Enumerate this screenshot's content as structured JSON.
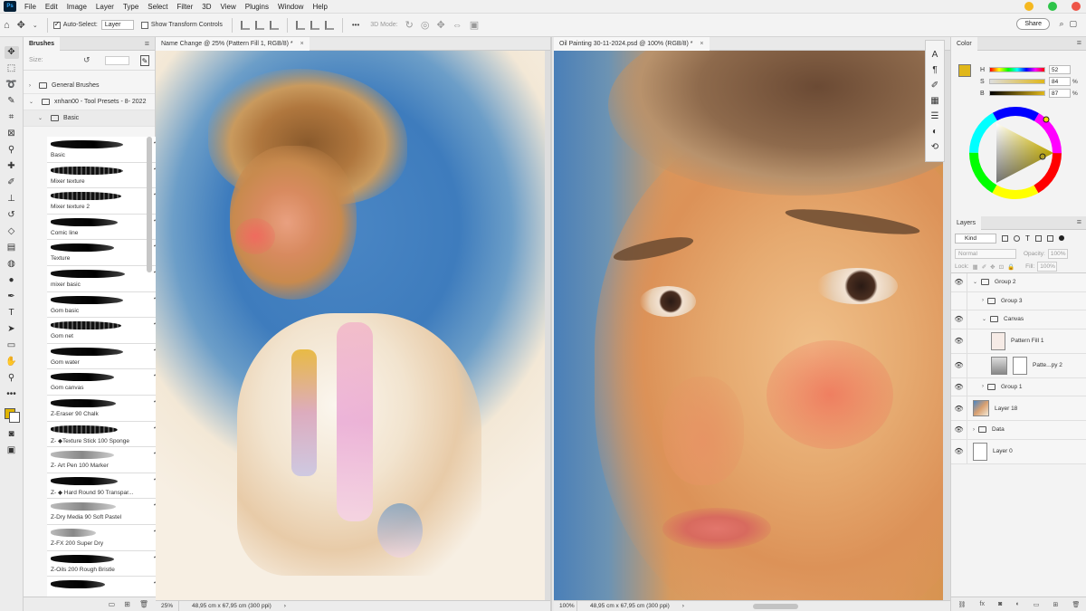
{
  "app": {
    "logo": "Ps",
    "menu": [
      "File",
      "Edit",
      "Image",
      "Layer",
      "Type",
      "Select",
      "Filter",
      "3D",
      "View",
      "Plugins",
      "Window",
      "Help"
    ],
    "window_controls": {
      "minimize_color": "#f5b820",
      "maximize_color": "#2ec449",
      "close_color": "#ee5548"
    }
  },
  "options_bar": {
    "auto_select_label": "Auto-Select:",
    "auto_select_checked": true,
    "auto_select_value": "Layer",
    "transform_label": "Show Transform Controls",
    "mode_3d_label": "3D Mode:",
    "more_label": "•••",
    "share_label": "Share"
  },
  "brushes": {
    "tab_label": "Brushes",
    "size_label": "Size:",
    "groups": [
      {
        "label": "General Brushes"
      },
      {
        "label": "xnhan00 - Tool Presets - 8- 2022"
      },
      {
        "label": "Basic"
      }
    ],
    "items": [
      {
        "name": "Basic"
      },
      {
        "name": "Mixer texture"
      },
      {
        "name": "Mixer texture 2"
      },
      {
        "name": "Comic line"
      },
      {
        "name": "Texture"
      },
      {
        "name": "mixer basic"
      },
      {
        "name": "Gom basic"
      },
      {
        "name": "Gom net"
      },
      {
        "name": "Gom water"
      },
      {
        "name": "Gom canvas"
      },
      {
        "name": "Z-Eraser 90 Chalk"
      },
      {
        "name": "Z- ◆Texture Stick 100 Sponge"
      },
      {
        "name": "Z- Art Pen 100 Marker"
      },
      {
        "name": "Z- ◆ Hard Round 90 Transpar..."
      },
      {
        "name": "Z-Dry Media 90 Soft Pastel"
      },
      {
        "name": "Z-FX 200 Super Dry"
      },
      {
        "name": "Z-Oils 200 Rough Bristle"
      },
      {
        "name": ""
      }
    ]
  },
  "documents": [
    {
      "tab_label": "Name Change @ 25% (Pattern Fill 1, RGB/8) *",
      "zoom": "25%",
      "info": "48,95 cm x 67,95 cm (300 ppi)"
    },
    {
      "tab_label": "Oil Painting 30-11-2024.psd @ 100% (RGB/8) *",
      "zoom": "100%",
      "info": "48,95 cm x 67,95 cm (300 ppi)"
    }
  ],
  "color_panel": {
    "tab_label": "Color",
    "fg_color": "#e0b71a",
    "h": {
      "label": "H",
      "value": "52"
    },
    "s": {
      "label": "S",
      "value": "84",
      "unit": "%"
    },
    "b": {
      "label": "B",
      "value": "87",
      "unit": "%"
    }
  },
  "layers_panel": {
    "tab_label": "Layers",
    "kind_label": "Kind",
    "blend_mode": "Normal",
    "opacity_label": "Opacity:",
    "opacity_value": "100%",
    "lock_label": "Lock:",
    "fill_label": "Fill:",
    "fill_value": "100%",
    "layers": [
      {
        "name": "Group 2",
        "type": "group",
        "visible": true,
        "indent": 0,
        "expanded": true
      },
      {
        "name": "Group 3",
        "type": "group",
        "visible": false,
        "indent": 1,
        "expanded": false
      },
      {
        "name": "Canvas",
        "type": "group",
        "visible": true,
        "indent": 1,
        "expanded": true
      },
      {
        "name": "Pattern Fill 1",
        "type": "pattern",
        "visible": true,
        "indent": 2
      },
      {
        "name": "Patte...py 2",
        "type": "mask",
        "visible": true,
        "indent": 2
      },
      {
        "name": "Group 1",
        "type": "group",
        "visible": true,
        "indent": 1,
        "expanded": false
      },
      {
        "name": "Layer 18",
        "type": "photo",
        "visible": true,
        "indent": 0
      },
      {
        "name": "Data",
        "type": "group",
        "visible": true,
        "indent": 0,
        "expanded": false
      },
      {
        "name": "Layer 0",
        "type": "white",
        "visible": true,
        "indent": 0
      }
    ]
  }
}
